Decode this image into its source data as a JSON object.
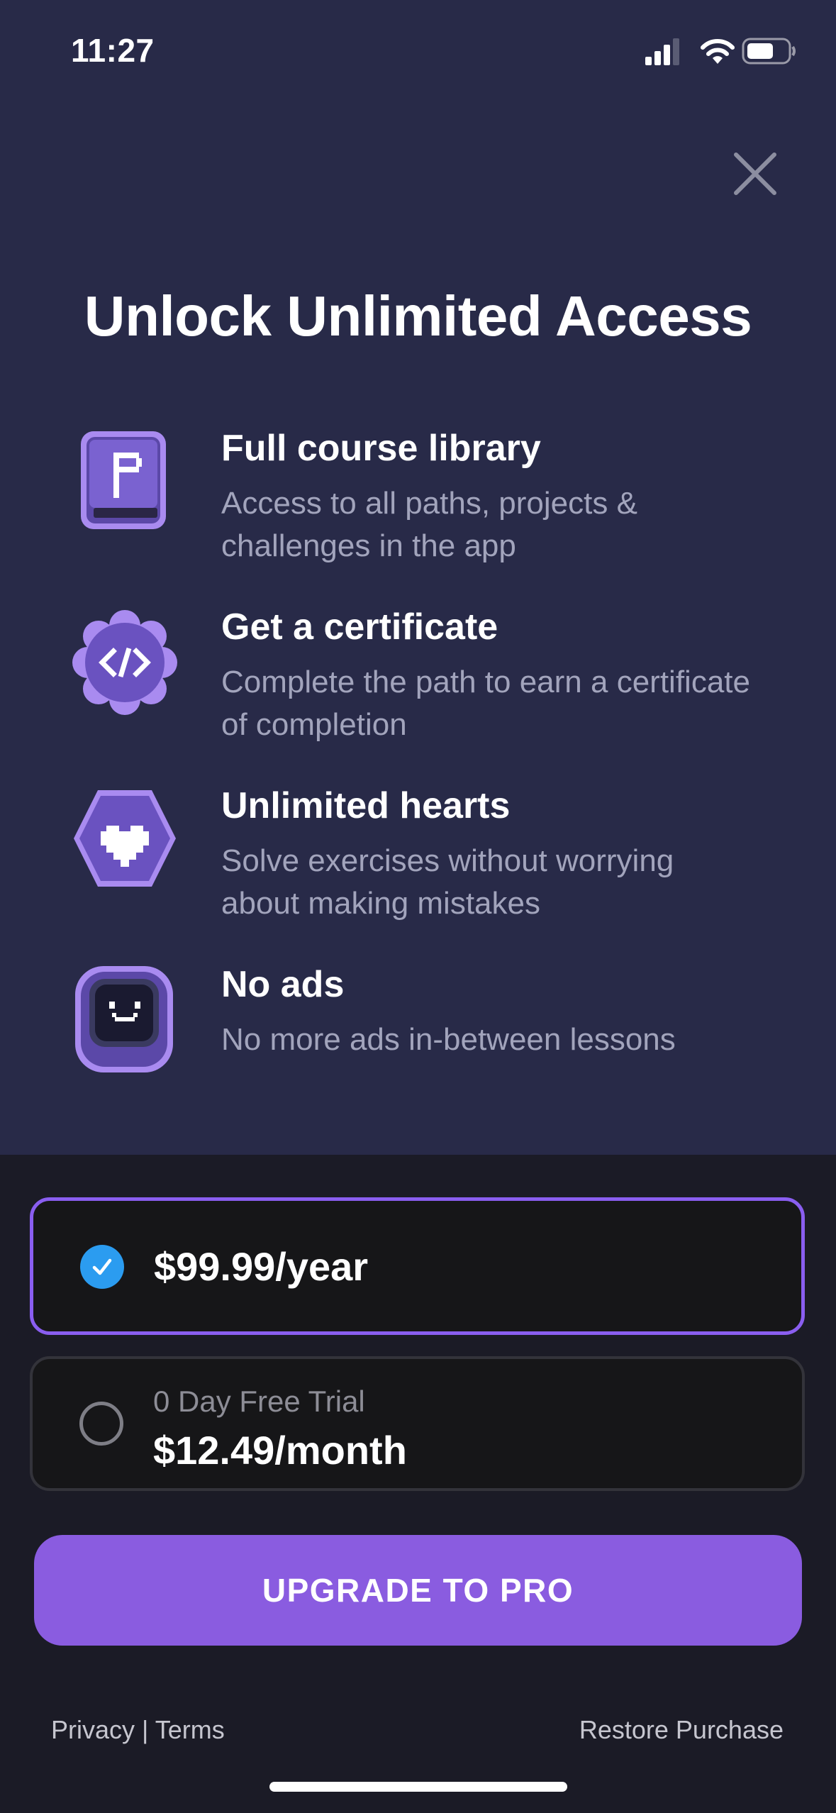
{
  "status_bar": {
    "time": "11:27",
    "icons": [
      "cellular-signal-icon",
      "wifi-icon",
      "battery-icon"
    ]
  },
  "close": {
    "icon": "close-icon"
  },
  "headline": "Unlock Unlimited Access",
  "features": [
    {
      "icon": "flag-book-icon",
      "title": "Full course library",
      "description": "Access to all paths, projects & challenges in the app"
    },
    {
      "icon": "code-certificate-badge-icon",
      "title": "Get a certificate",
      "description": "Complete the path to earn a certificate of completion"
    },
    {
      "icon": "heart-hexagon-icon",
      "title": "Unlimited hearts",
      "description": "Solve exercises without worrying about making mistakes"
    },
    {
      "icon": "robot-face-icon",
      "title": "No ads",
      "description": "No more ads in-between lessons"
    }
  ],
  "plans": [
    {
      "price": "$99.99/year",
      "trial": "",
      "selected": true
    },
    {
      "price": "$12.49/month",
      "trial": "0 Day Free Trial",
      "selected": false
    }
  ],
  "cta": {
    "label": "UPGRADE TO PRO"
  },
  "footer": {
    "privacy": "Privacy",
    "separator": " | ",
    "terms": "Terms",
    "restore": "Restore Purchase"
  },
  "colors": {
    "top_background": "#282a48",
    "bottom_background": "#1b1b26",
    "accent_purple": "#8a5ce0",
    "selected_border": "#8a5ef0",
    "check_blue": "#2b9cf0",
    "muted_text": "#a2a4bc"
  }
}
